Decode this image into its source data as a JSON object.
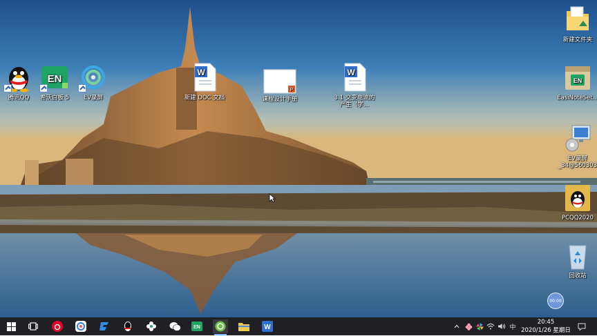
{
  "desktop": {
    "icons": [
      {
        "label": "腾讯QQ"
      },
      {
        "label": "希沃白板 5"
      },
      {
        "label": "EV录屏"
      },
      {
        "label": "新建 DOC 文档"
      },
      {
        "label": "课程设计手册"
      },
      {
        "label": "3.1 交变电流的产生（学..."
      },
      {
        "label": "新建文件夹"
      },
      {
        "label": "EasiNoteSet..."
      },
      {
        "label": "EV录屏_34@560303"
      },
      {
        "label": "PCQQ2020"
      },
      {
        "label": "回收站"
      }
    ],
    "floating_ball_text": "00:00"
  },
  "taskbar": {
    "apps": [
      "start",
      "task-view",
      "netease-music",
      "app-quark",
      "app-lightning",
      "qq",
      "app-flower",
      "wechat",
      "easinote",
      "app-green-circle",
      "file-explorer",
      "wps"
    ],
    "tray": {
      "ime": "中",
      "time": "20:45",
      "date": "2020/1/26 星期日"
    }
  },
  "colors": {
    "taskbar_bg": "#1f1f24",
    "active_indicator": "#7ab3ff"
  }
}
